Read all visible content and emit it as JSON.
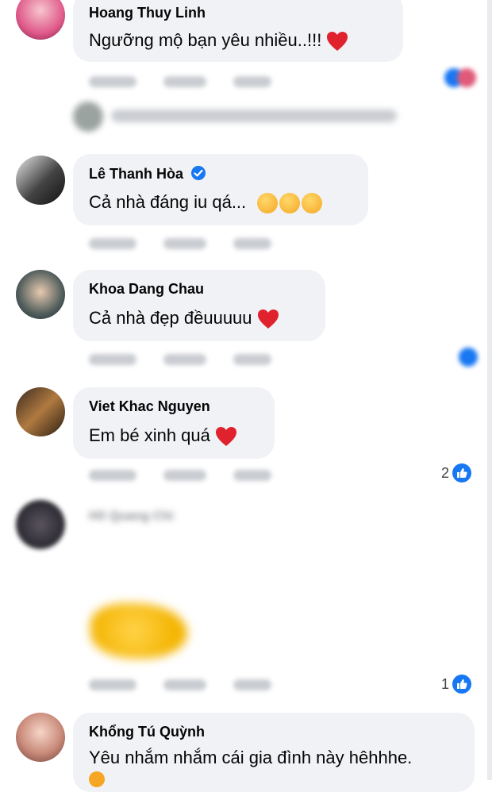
{
  "comments": [
    {
      "name": "Hoang Thuy Linh",
      "text": "Ngưỡng mộ bạn yêu nhiều..!!!"
    },
    {
      "name": "Lê Thanh Hòa",
      "text": "Cả nhà đáng iu qá..."
    },
    {
      "name": "Khoa Dang Chau",
      "text": "Cả nhà đẹp đềuuuuu"
    },
    {
      "name": "Viet Khac Nguyen",
      "text": "Em bé xinh quá",
      "reaction_count": "2"
    },
    {
      "name": "Hồ Quang Chi",
      "reaction_count": "1"
    },
    {
      "name": "Khổng Tú Quỳnh",
      "text": "Yêu nhắm nhắm cái gia đình này hêhhhe."
    }
  ],
  "colors": {
    "bubble": "#f0f2f5",
    "like": "#1877f2",
    "heart": "#e0212e",
    "verified": "#1877f2"
  },
  "icons": [
    "heart-icon",
    "verified-badge-icon",
    "like-icon",
    "smiling-hearts-emoji",
    "worried-emoji"
  ]
}
